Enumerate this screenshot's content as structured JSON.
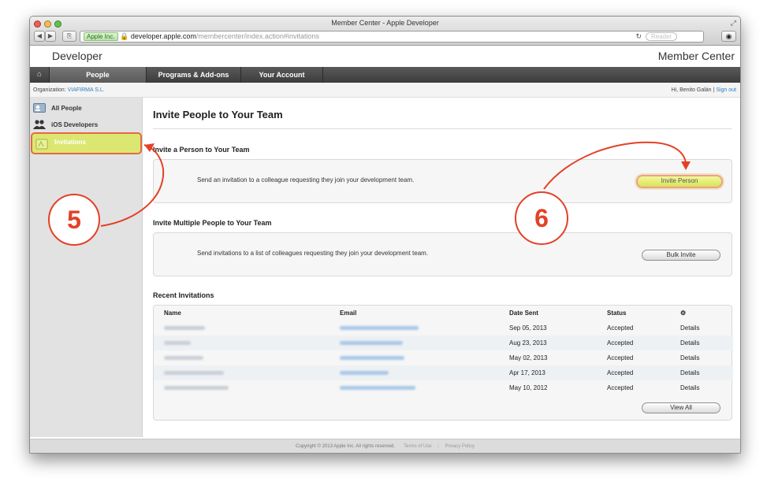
{
  "browser": {
    "title": "Member Center - Apple Developer",
    "org_badge": "Apple Inc.",
    "url_host": "developer.apple.com",
    "url_path": "/membercenter/index.action#invitations",
    "reader_label": "Reader",
    "back_icon": "back-arrow-icon",
    "forward_icon": "forward-arrow-icon"
  },
  "header": {
    "brand": "Developer",
    "section": "Member Center"
  },
  "nav": {
    "tabs": [
      {
        "label": "People",
        "active": true
      },
      {
        "label": "Programs & Add-ons",
        "active": false
      },
      {
        "label": "Your Account",
        "active": false
      }
    ]
  },
  "org": {
    "label": "Organization:",
    "name": "VIAFIRMA S.L.",
    "greeting": "Hi, Benito Galán",
    "divider": "|",
    "signout": "Sign out"
  },
  "sidebar": {
    "items": [
      {
        "label": "All People",
        "icon": "people-card-icon"
      },
      {
        "label": "iOS Developers",
        "icon": "group-icon"
      },
      {
        "label": "Invitations",
        "icon": "invitation-icon",
        "active": true
      }
    ]
  },
  "main": {
    "title": "Invite People to Your Team",
    "invite_single": {
      "heading": "Invite a Person to Your Team",
      "desc": "Send an invitation to a colleague requesting they join your development team.",
      "button": "Invite Person"
    },
    "invite_multi": {
      "heading": "Invite Multiple People to Your Team",
      "desc": "Send invitations to a list of colleagues requesting they join your development team.",
      "button": "Bulk Invite"
    },
    "recent": {
      "heading": "Recent Invitations",
      "columns": [
        "Name",
        "Email",
        "Date Sent",
        "Status",
        "⚙"
      ],
      "rows": [
        {
          "date": "Sep 05, 2013",
          "status": "Accepted",
          "action": "Details"
        },
        {
          "date": "Aug 23, 2013",
          "status": "Accepted",
          "action": "Details"
        },
        {
          "date": "May 02, 2013",
          "status": "Accepted",
          "action": "Details"
        },
        {
          "date": "Apr 17, 2013",
          "status": "Accepted",
          "action": "Details"
        },
        {
          "date": "May 10, 2012",
          "status": "Accepted",
          "action": "Details"
        }
      ],
      "view_all": "View All"
    }
  },
  "footer": {
    "copyright": "Copyright © 2013 Apple Inc. All rights reserved.",
    "terms": "Terms of Use",
    "divider": "|",
    "privacy": "Privacy Policy"
  },
  "annotations": {
    "step5": "5",
    "step6": "6",
    "color": "#e34127"
  }
}
